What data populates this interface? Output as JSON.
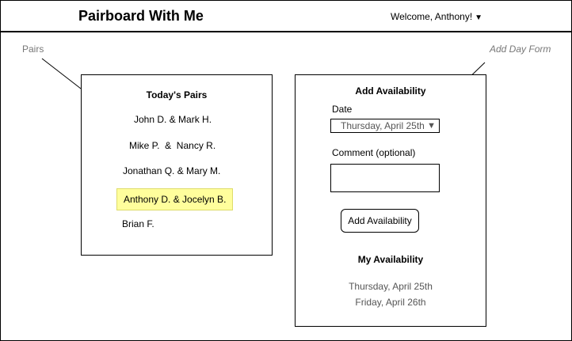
{
  "header": {
    "app_title": "Pairboard With Me",
    "user_menu": "Welcome, Anthony!",
    "caret": "▼"
  },
  "annotations": {
    "pairs": "Pairs",
    "add_day_form": "Add Day Form"
  },
  "pairs_panel": {
    "heading": "Today's Pairs",
    "pairs": [
      "John D. & Mark H.",
      "Mike P.  &  Nancy R.",
      "Jonathan Q. & Mary M.",
      "Anthony D. & Jocelyn B.",
      "Brian F."
    ]
  },
  "form_panel": {
    "heading": "Add Availability",
    "date_label": "Date",
    "date_value": "Thursday, April 25th",
    "date_arrow": "▼",
    "comment_label": "Comment (optional)",
    "comment_value": "",
    "submit_label": "Add Availability",
    "my_availability_heading": "My Availability",
    "availability": [
      "Thursday, April 25th",
      "Friday, April 26th"
    ]
  },
  "colors": {
    "highlight": "#fffe9c",
    "annotation": "#777777"
  }
}
